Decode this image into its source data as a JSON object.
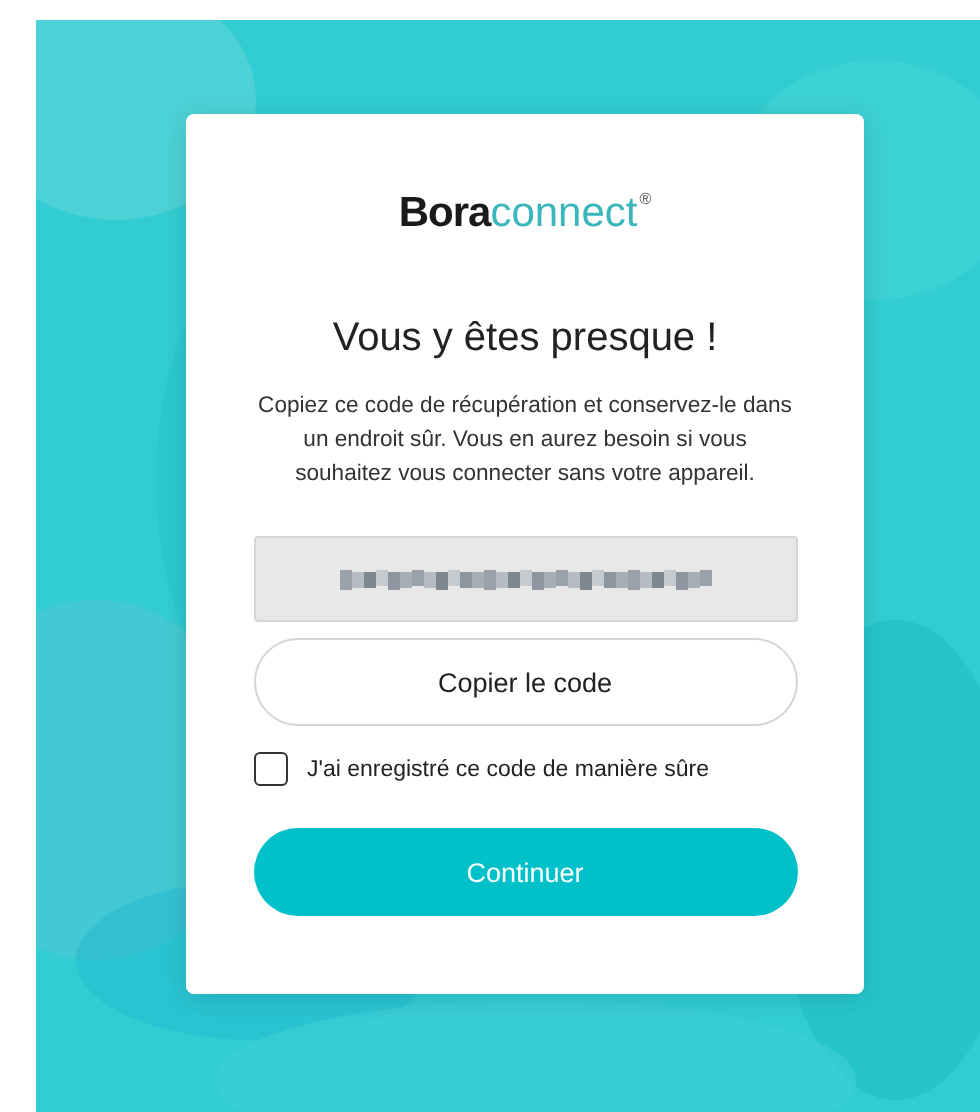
{
  "logo": {
    "brand": "Bora",
    "product": "connect",
    "mark": "®"
  },
  "title": "Vous y êtes presque !",
  "message": "Copiez ce code de récupération et conservez-le dans un endroit sûr. Vous en aurez besoin si vous souhaitez vous connecter sans votre appareil.",
  "copy_button": "Copier le code",
  "confirm": {
    "label": "J'ai enregistré ce code de manière sûre",
    "checked": false
  },
  "continue_button": "Continuer"
}
